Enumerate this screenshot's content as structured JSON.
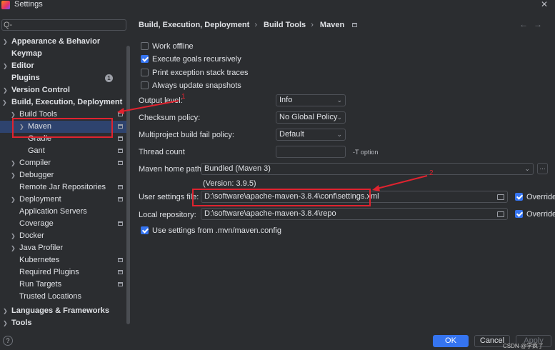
{
  "window": {
    "title": "Settings",
    "close_glyph": "✕"
  },
  "sidebar": {
    "search_glyph": "Q-",
    "items": [
      {
        "label": "Appearance & Behavior"
      },
      {
        "label": "Keymap"
      },
      {
        "label": "Editor"
      },
      {
        "label": "Plugins",
        "badge": "1"
      },
      {
        "label": "Version Control"
      },
      {
        "label": "Build, Execution, Deployment"
      },
      {
        "label": "Build Tools"
      },
      {
        "label": "Maven"
      },
      {
        "label": "Gradle"
      },
      {
        "label": "Gant"
      },
      {
        "label": "Compiler"
      },
      {
        "label": "Debugger"
      },
      {
        "label": "Remote Jar Repositories"
      },
      {
        "label": "Deployment"
      },
      {
        "label": "Application Servers"
      },
      {
        "label": "Coverage"
      },
      {
        "label": "Docker"
      },
      {
        "label": "Java Profiler"
      },
      {
        "label": "Kubernetes"
      },
      {
        "label": "Required Plugins"
      },
      {
        "label": "Run Targets"
      },
      {
        "label": "Trusted Locations"
      },
      {
        "label": "Languages & Frameworks"
      },
      {
        "label": "Tools"
      }
    ]
  },
  "breadcrumb": [
    "Build, Execution, Deployment",
    "Build Tools",
    "Maven"
  ],
  "breadcrumb_sep": "›",
  "nav": {
    "back": "←",
    "forward": "→"
  },
  "options": {
    "work_offline": {
      "label": "Work offline",
      "checked": false
    },
    "execute_goals": {
      "label": "Execute goals recursively",
      "checked": true
    },
    "print_stack": {
      "label": "Print exception stack traces",
      "checked": false
    },
    "always_update": {
      "label": "Always update snapshots",
      "checked": false
    },
    "use_mvn_config": {
      "label": "Use settings from .mvn/maven.config",
      "checked": true
    }
  },
  "fields": {
    "output_level": {
      "label": "Output level:",
      "value": "Info"
    },
    "checksum_policy": {
      "label": "Checksum policy:",
      "value": "No Global Policy"
    },
    "multiproject": {
      "label": "Multiproject build fail policy:",
      "value": "Default"
    },
    "thread_count": {
      "label": "Thread count",
      "value": "",
      "hint": "-T option"
    },
    "maven_home": {
      "label": "Maven home path:",
      "value": "Bundled (Maven 3)",
      "version": "(Version: 3.9.5)",
      "browse": "..."
    },
    "user_settings": {
      "label": "User settings file:",
      "value": "D:\\software\\apache-maven-3.8.4\\conf\\settings.xml",
      "override": "Override"
    },
    "local_repo": {
      "label": "Local repository:",
      "value": "D:\\software\\apache-maven-3.8.4\\repo",
      "override": "Override"
    }
  },
  "annotations": {
    "one": "1",
    "two": "2"
  },
  "footer": {
    "help": "?",
    "ok": "OK",
    "cancel": "Cancel",
    "apply": "Apply",
    "watermark": "CSDN @学疯了"
  },
  "colors": {
    "accent": "#3574f0",
    "selection": "#2e436e",
    "annotation": "#e0232f",
    "background": "#2b2d30"
  }
}
